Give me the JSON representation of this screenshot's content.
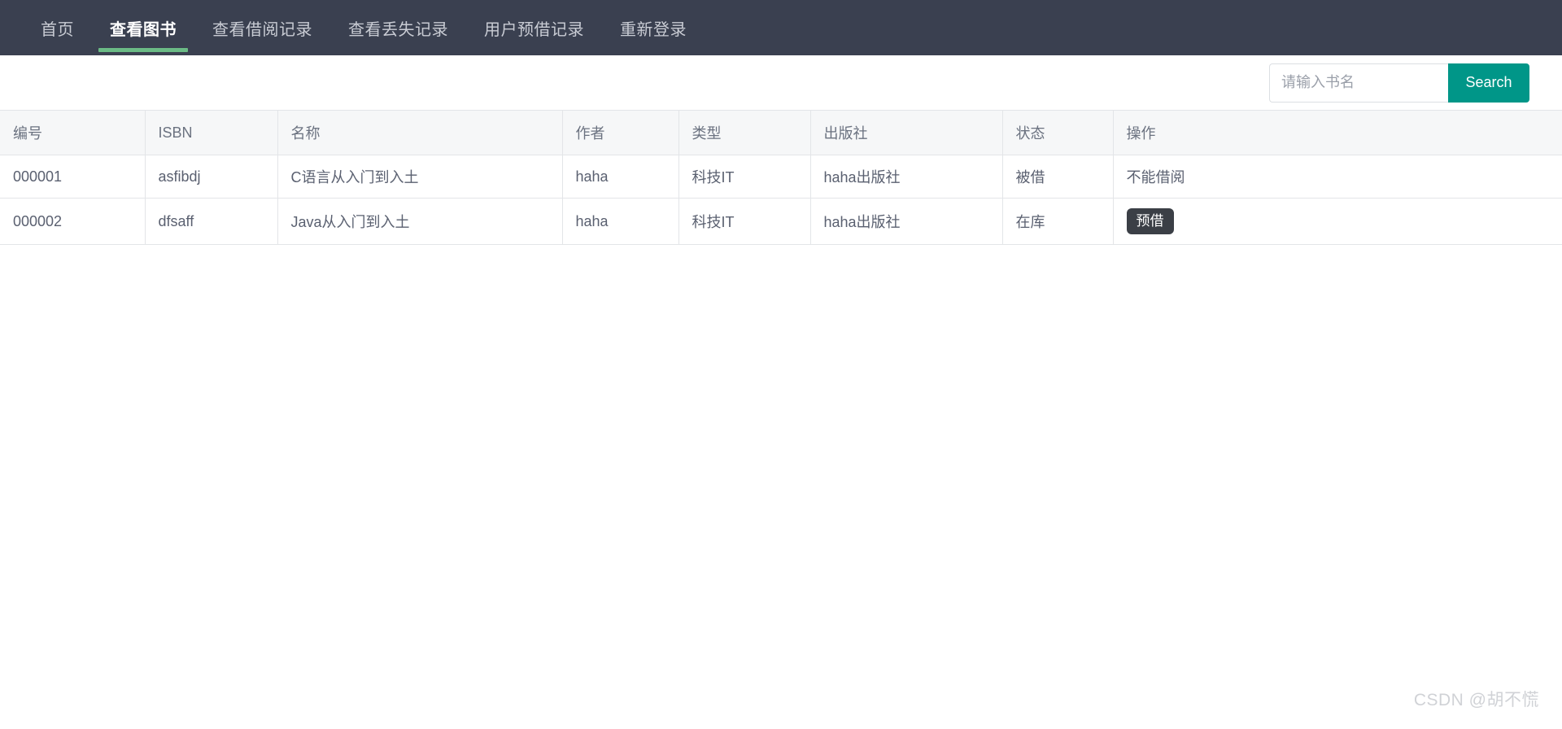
{
  "navbar": {
    "items": [
      {
        "label": "首页",
        "active": false
      },
      {
        "label": "查看图书",
        "active": true
      },
      {
        "label": "查看借阅记录",
        "active": false
      },
      {
        "label": "查看丢失记录",
        "active": false
      },
      {
        "label": "用户预借记录",
        "active": false
      },
      {
        "label": "重新登录",
        "active": false
      }
    ],
    "background_color": "#3a4050",
    "active_indicator_color": "#6bbb86"
  },
  "search": {
    "placeholder": "请输入书名",
    "value": "",
    "button_label": "Search",
    "button_color": "#009688"
  },
  "table": {
    "headers": [
      "编号",
      "ISBN",
      "名称",
      "作者",
      "类型",
      "出版社",
      "状态",
      "操作"
    ],
    "rows": [
      {
        "id": "000001",
        "isbn": "asfibdj",
        "name": "C语言从入门到入土",
        "author": "haha",
        "type": "科技IT",
        "publisher": "haha出版社",
        "status": "被借",
        "action_text": "不能借阅",
        "action_is_button": false
      },
      {
        "id": "000002",
        "isbn": "dfsaff",
        "name": "Java从入门到入土",
        "author": "haha",
        "type": "科技IT",
        "publisher": "haha出版社",
        "status": "在库",
        "action_text": "预借",
        "action_is_button": true
      }
    ]
  },
  "watermark": {
    "text": "CSDN @胡不慌"
  }
}
